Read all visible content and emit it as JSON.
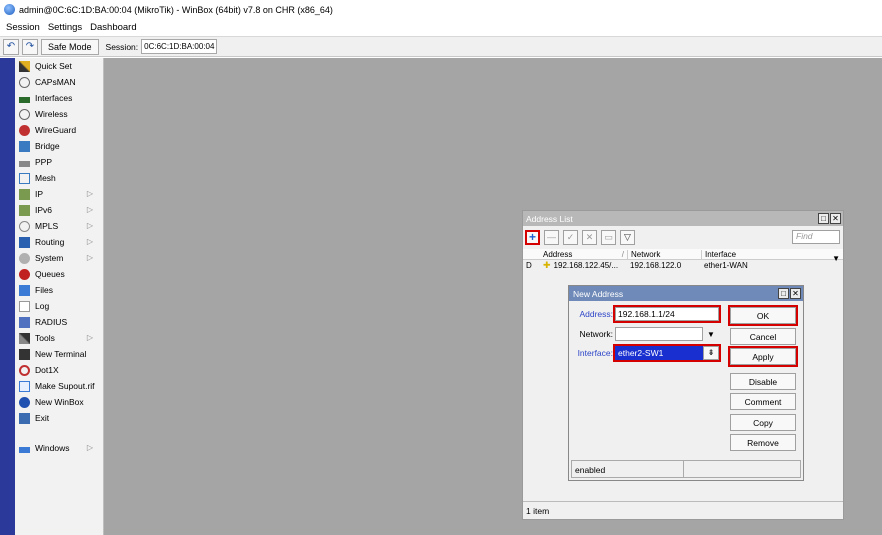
{
  "window": {
    "title": "admin@0C:6C:1D:BA:00:04 (MikroTik) - WinBox (64bit) v7.8 on CHR (x86_64)"
  },
  "menu": [
    "Session",
    "Settings",
    "Dashboard"
  ],
  "toolbar": {
    "undo": "↶",
    "redo": "↷",
    "safe_mode": "Safe Mode",
    "session_label": "Session:",
    "session_value": "0C:6C:1D:BA:00:04"
  },
  "sidebar": {
    "items": [
      {
        "label": "Quick Set",
        "icon": "wand-icon",
        "sub": false
      },
      {
        "label": "CAPsMAN",
        "icon": "antenna-icon",
        "sub": false
      },
      {
        "label": "Interfaces",
        "icon": "ports-icon",
        "sub": false
      },
      {
        "label": "Wireless",
        "icon": "antenna-icon",
        "sub": false
      },
      {
        "label": "WireGuard",
        "icon": "wireguard-icon",
        "sub": false
      },
      {
        "label": "Bridge",
        "icon": "bridge-icon",
        "sub": false
      },
      {
        "label": "PPP",
        "icon": "ppp-icon",
        "sub": false
      },
      {
        "label": "Mesh",
        "icon": "mesh-icon",
        "sub": false
      },
      {
        "label": "IP",
        "icon": "ip-icon",
        "sub": true
      },
      {
        "label": "IPv6",
        "icon": "ipv6-icon",
        "sub": true
      },
      {
        "label": "MPLS",
        "icon": "mpls-icon",
        "sub": true
      },
      {
        "label": "Routing",
        "icon": "routing-icon",
        "sub": true
      },
      {
        "label": "System",
        "icon": "gear-icon",
        "sub": true
      },
      {
        "label": "Queues",
        "icon": "queues-icon",
        "sub": false
      },
      {
        "label": "Files",
        "icon": "folder-icon",
        "sub": false
      },
      {
        "label": "Log",
        "icon": "log-icon",
        "sub": false
      },
      {
        "label": "RADIUS",
        "icon": "radius-icon",
        "sub": false
      },
      {
        "label": "Tools",
        "icon": "tools-icon",
        "sub": true
      },
      {
        "label": "New Terminal",
        "icon": "terminal-icon",
        "sub": false
      },
      {
        "label": "Dot1X",
        "icon": "dot1x-icon",
        "sub": false
      },
      {
        "label": "Make Supout.rif",
        "icon": "supout-icon",
        "sub": false
      },
      {
        "label": "New WinBox",
        "icon": "winbox-icon",
        "sub": false
      },
      {
        "label": "Exit",
        "icon": "exit-icon",
        "sub": false
      }
    ],
    "windows_item": {
      "label": "Windows",
      "icon": "windows-icon"
    },
    "submenu_arrow": "▷"
  },
  "address_list": {
    "title": "Address List",
    "find_placeholder": "Find",
    "columns": [
      "",
      "Address",
      "/",
      "Network",
      "Interface"
    ],
    "rows": [
      {
        "flag": "D",
        "address": "192.168.122.45/...",
        "network": "192.168.122.0",
        "interface": "ether1-WAN"
      }
    ],
    "status": "1 item"
  },
  "new_address": {
    "title": "New Address",
    "address_label": "Address:",
    "address_value": "192.168.1.1/24",
    "network_label": "Network:",
    "network_value": "",
    "interface_label": "Interface:",
    "interface_value": "ether2-SW1",
    "buttons": {
      "ok": "OK",
      "cancel": "Cancel",
      "apply": "Apply",
      "disable": "Disable",
      "comment": "Comment",
      "copy": "Copy",
      "remove": "Remove"
    },
    "status": "enabled"
  },
  "colors": {
    "accent_red": "#d40000",
    "sidebar_strip": "#2b3a9a",
    "workspace": "#a5a5a5",
    "active_title": "#6f8ab8",
    "label_blue": "#2d45c8"
  }
}
